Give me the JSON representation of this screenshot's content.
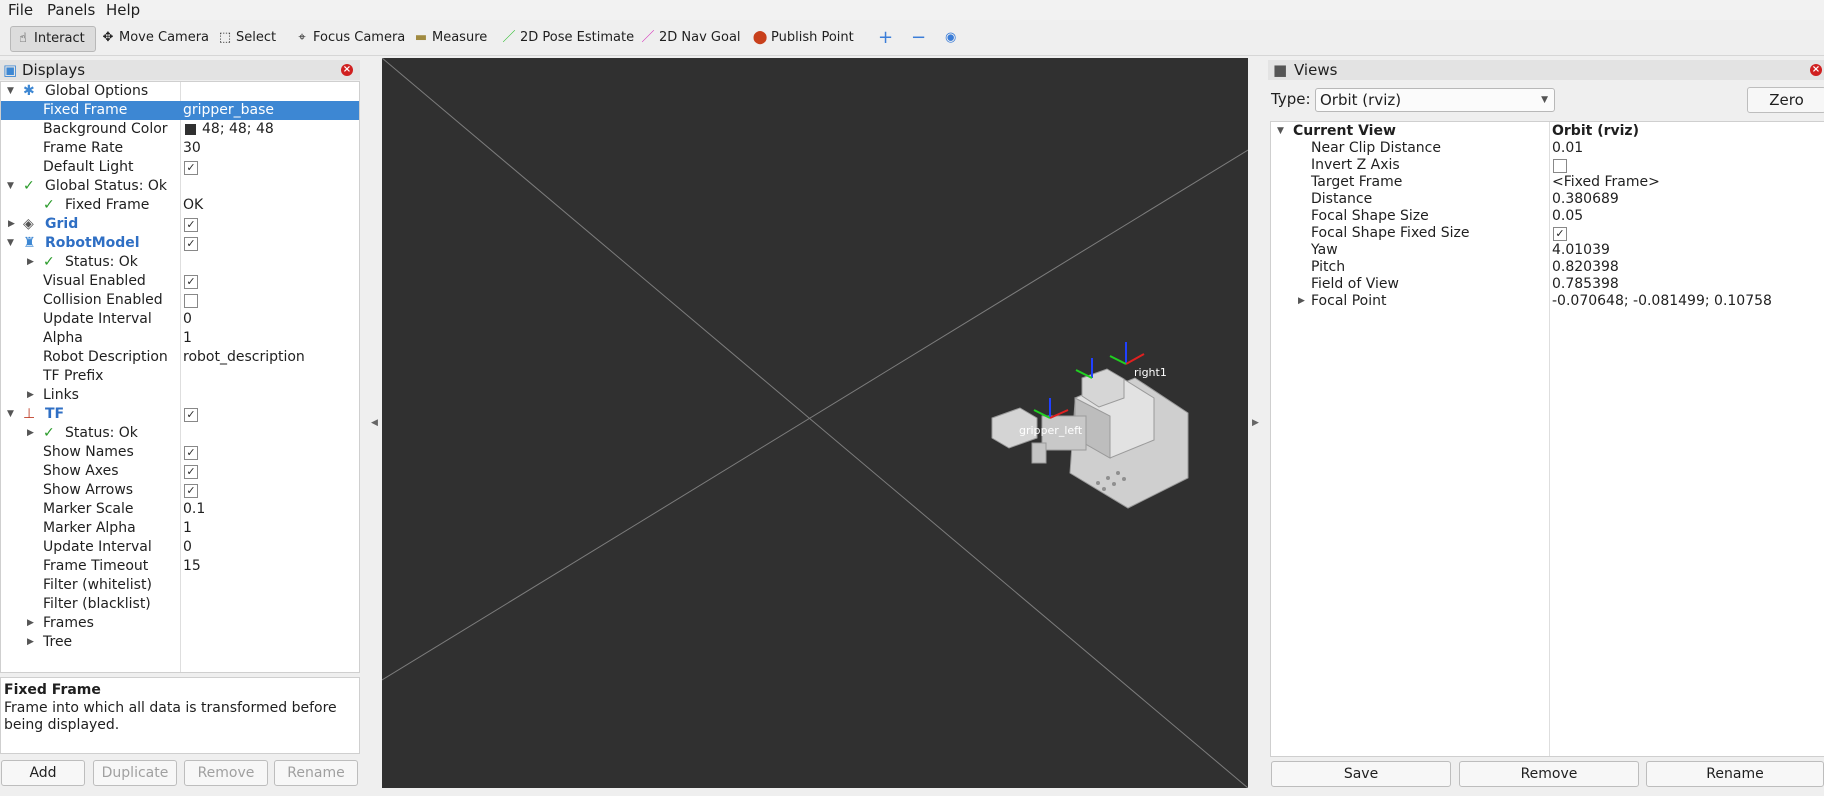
{
  "menu": {
    "file": "File",
    "panels": "Panels",
    "help": "Help"
  },
  "toolbar": {
    "interact": "Interact",
    "move_camera": "Move Camera",
    "select": "Select",
    "focus_camera": "Focus Camera",
    "measure": "Measure",
    "pose_estimate": "2D Pose Estimate",
    "nav_goal": "2D Nav Goal",
    "publish_point": "Publish Point"
  },
  "displays": {
    "title": "Displays",
    "rows": [
      {
        "label": "Global Options"
      },
      {
        "label": "Fixed Frame",
        "value": "gripper_base"
      },
      {
        "label": "Background Color",
        "value": "48; 48; 48"
      },
      {
        "label": "Frame Rate",
        "value": "30"
      },
      {
        "label": "Default Light"
      },
      {
        "label": "Global Status: Ok"
      },
      {
        "label": "Fixed Frame",
        "value": "OK"
      },
      {
        "label": "Grid"
      },
      {
        "label": "RobotModel"
      },
      {
        "label": "Status: Ok"
      },
      {
        "label": "Visual Enabled"
      },
      {
        "label": "Collision Enabled"
      },
      {
        "label": "Update Interval",
        "value": "0"
      },
      {
        "label": "Alpha",
        "value": "1"
      },
      {
        "label": "Robot Description",
        "value": "robot_description"
      },
      {
        "label": "TF Prefix"
      },
      {
        "label": "Links"
      },
      {
        "label": "TF"
      },
      {
        "label": "Status: Ok"
      },
      {
        "label": "Show Names"
      },
      {
        "label": "Show Axes"
      },
      {
        "label": "Show Arrows"
      },
      {
        "label": "Marker Scale",
        "value": "0.1"
      },
      {
        "label": "Marker Alpha",
        "value": "1"
      },
      {
        "label": "Update Interval",
        "value": "0"
      },
      {
        "label": "Frame Timeout",
        "value": "15"
      },
      {
        "label": "Filter (whitelist)"
      },
      {
        "label": "Filter (blacklist)"
      },
      {
        "label": "Frames"
      },
      {
        "label": "Tree"
      }
    ],
    "help_title": "Fixed Frame",
    "help_text": "Frame into which all data is transformed before being displayed.",
    "buttons": {
      "add": "Add",
      "duplicate": "Duplicate",
      "remove": "Remove",
      "rename": "Rename"
    }
  },
  "viewport": {
    "label_right": "right1",
    "label_left": "gripper_left"
  },
  "views": {
    "title": "Views",
    "type_label": "Type:",
    "type_value": "Orbit (rviz)",
    "zero": "Zero",
    "header_label": "Current View",
    "header_value": "Orbit (rviz)",
    "rows": [
      {
        "label": "Near Clip Distance",
        "value": "0.01"
      },
      {
        "label": "Invert Z Axis",
        "value": ""
      },
      {
        "label": "Target Frame",
        "value": "<Fixed Frame>"
      },
      {
        "label": "Distance",
        "value": "0.380689"
      },
      {
        "label": "Focal Shape Size",
        "value": "0.05"
      },
      {
        "label": "Focal Shape Fixed Size",
        "value": ""
      },
      {
        "label": "Yaw",
        "value": "4.01039"
      },
      {
        "label": "Pitch",
        "value": "0.820398"
      },
      {
        "label": "Field of View",
        "value": "0.785398"
      },
      {
        "label": "Focal Point",
        "value": "-0.070648; -0.081499; 0.10758"
      }
    ],
    "buttons": {
      "save": "Save",
      "remove": "Remove",
      "rename": "Rename"
    }
  },
  "colors": {
    "selection": "#3d87d3",
    "viewport_bg": "#303030",
    "link_blue": "#2f6fc4"
  }
}
